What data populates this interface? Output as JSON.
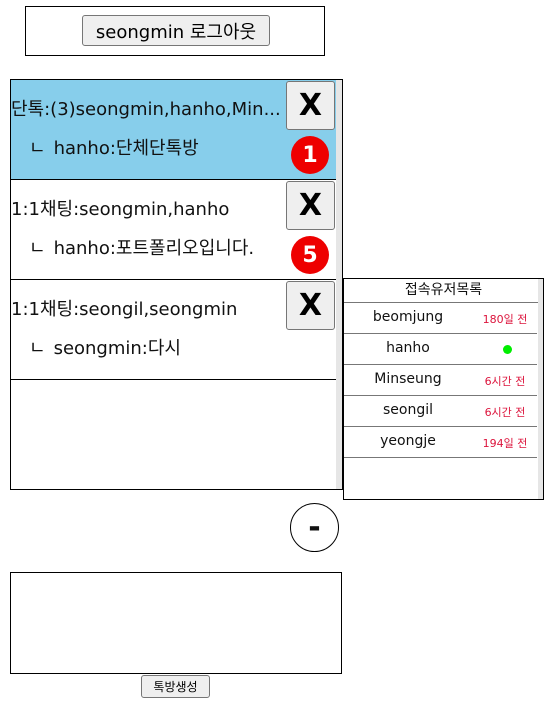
{
  "header": {
    "logout_label": "seongmin 로그아웃"
  },
  "rooms": [
    {
      "title": "단톡:(3)seongmin,hanho,Min...",
      "last_message": "hanho:단체단톡방",
      "unread": "1",
      "close_label": "X",
      "selected": true
    },
    {
      "title": "1:1채팅:seongmin,hanho",
      "last_message": "hanho:포트폴리오입니다.",
      "unread": "5",
      "close_label": "X",
      "selected": false
    },
    {
      "title": "1:1채팅:seongil,seongmin",
      "last_message": "seongmin:다시",
      "unread": "",
      "close_label": "X",
      "selected": false
    }
  ],
  "last_message_prefix": "ㄴ",
  "users_panel": {
    "title": "접속유저목록",
    "users": [
      {
        "name": "beomjung",
        "status": "180일 전",
        "online": false
      },
      {
        "name": "hanho",
        "status": "",
        "online": true
      },
      {
        "name": "Minseung",
        "status": "6시간 전",
        "online": false
      },
      {
        "name": "seongil",
        "status": "6시간 전",
        "online": false
      },
      {
        "name": "yeongje",
        "status": "194일 전",
        "online": false
      }
    ]
  },
  "minus_label": "-",
  "create_room_label": "톡방생성",
  "colors": {
    "selected_room": "#87ceeb",
    "badge": "#ee0000",
    "offline_time": "#dc143c",
    "online_dot": "#00ee00"
  }
}
